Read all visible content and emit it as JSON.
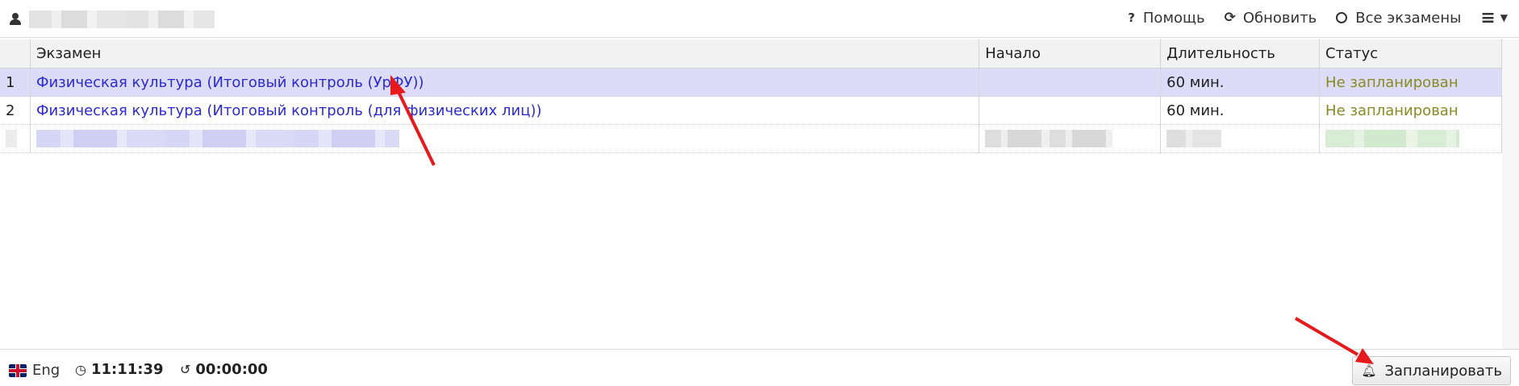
{
  "toolbar": {
    "help": "Помощь",
    "refresh": "Обновить",
    "all_exams": "Все экзамены"
  },
  "table": {
    "headers": {
      "exam": "Экзамен",
      "start": "Начало",
      "duration": "Длительность",
      "status": "Статус"
    },
    "rows": [
      {
        "num": "1",
        "exam": "Физическая культура (Итоговый контроль (УрФУ))",
        "start": "",
        "duration": "60 мин.",
        "status": "Не запланирован"
      },
      {
        "num": "2",
        "exam": "Физическая культура (Итоговый контроль (для физических лиц))",
        "start": "",
        "duration": "60 мин.",
        "status": "Не запланирован"
      }
    ]
  },
  "statusbar": {
    "language": "Eng",
    "clock_time": "11:11:39",
    "timer": "00:00:00",
    "schedule_button": "Запланировать"
  },
  "colors": {
    "link": "#2a2ad8",
    "status": "#8a8a22",
    "selected_row": "#dcdcf8",
    "annotation_arrow": "#e8191b"
  },
  "icons": [
    "user-icon",
    "question-icon",
    "refresh-icon",
    "circle-icon",
    "hamburger-icon",
    "caret-down-icon",
    "uk-flag-icon",
    "clock-icon",
    "history-icon",
    "bell-icon"
  ]
}
